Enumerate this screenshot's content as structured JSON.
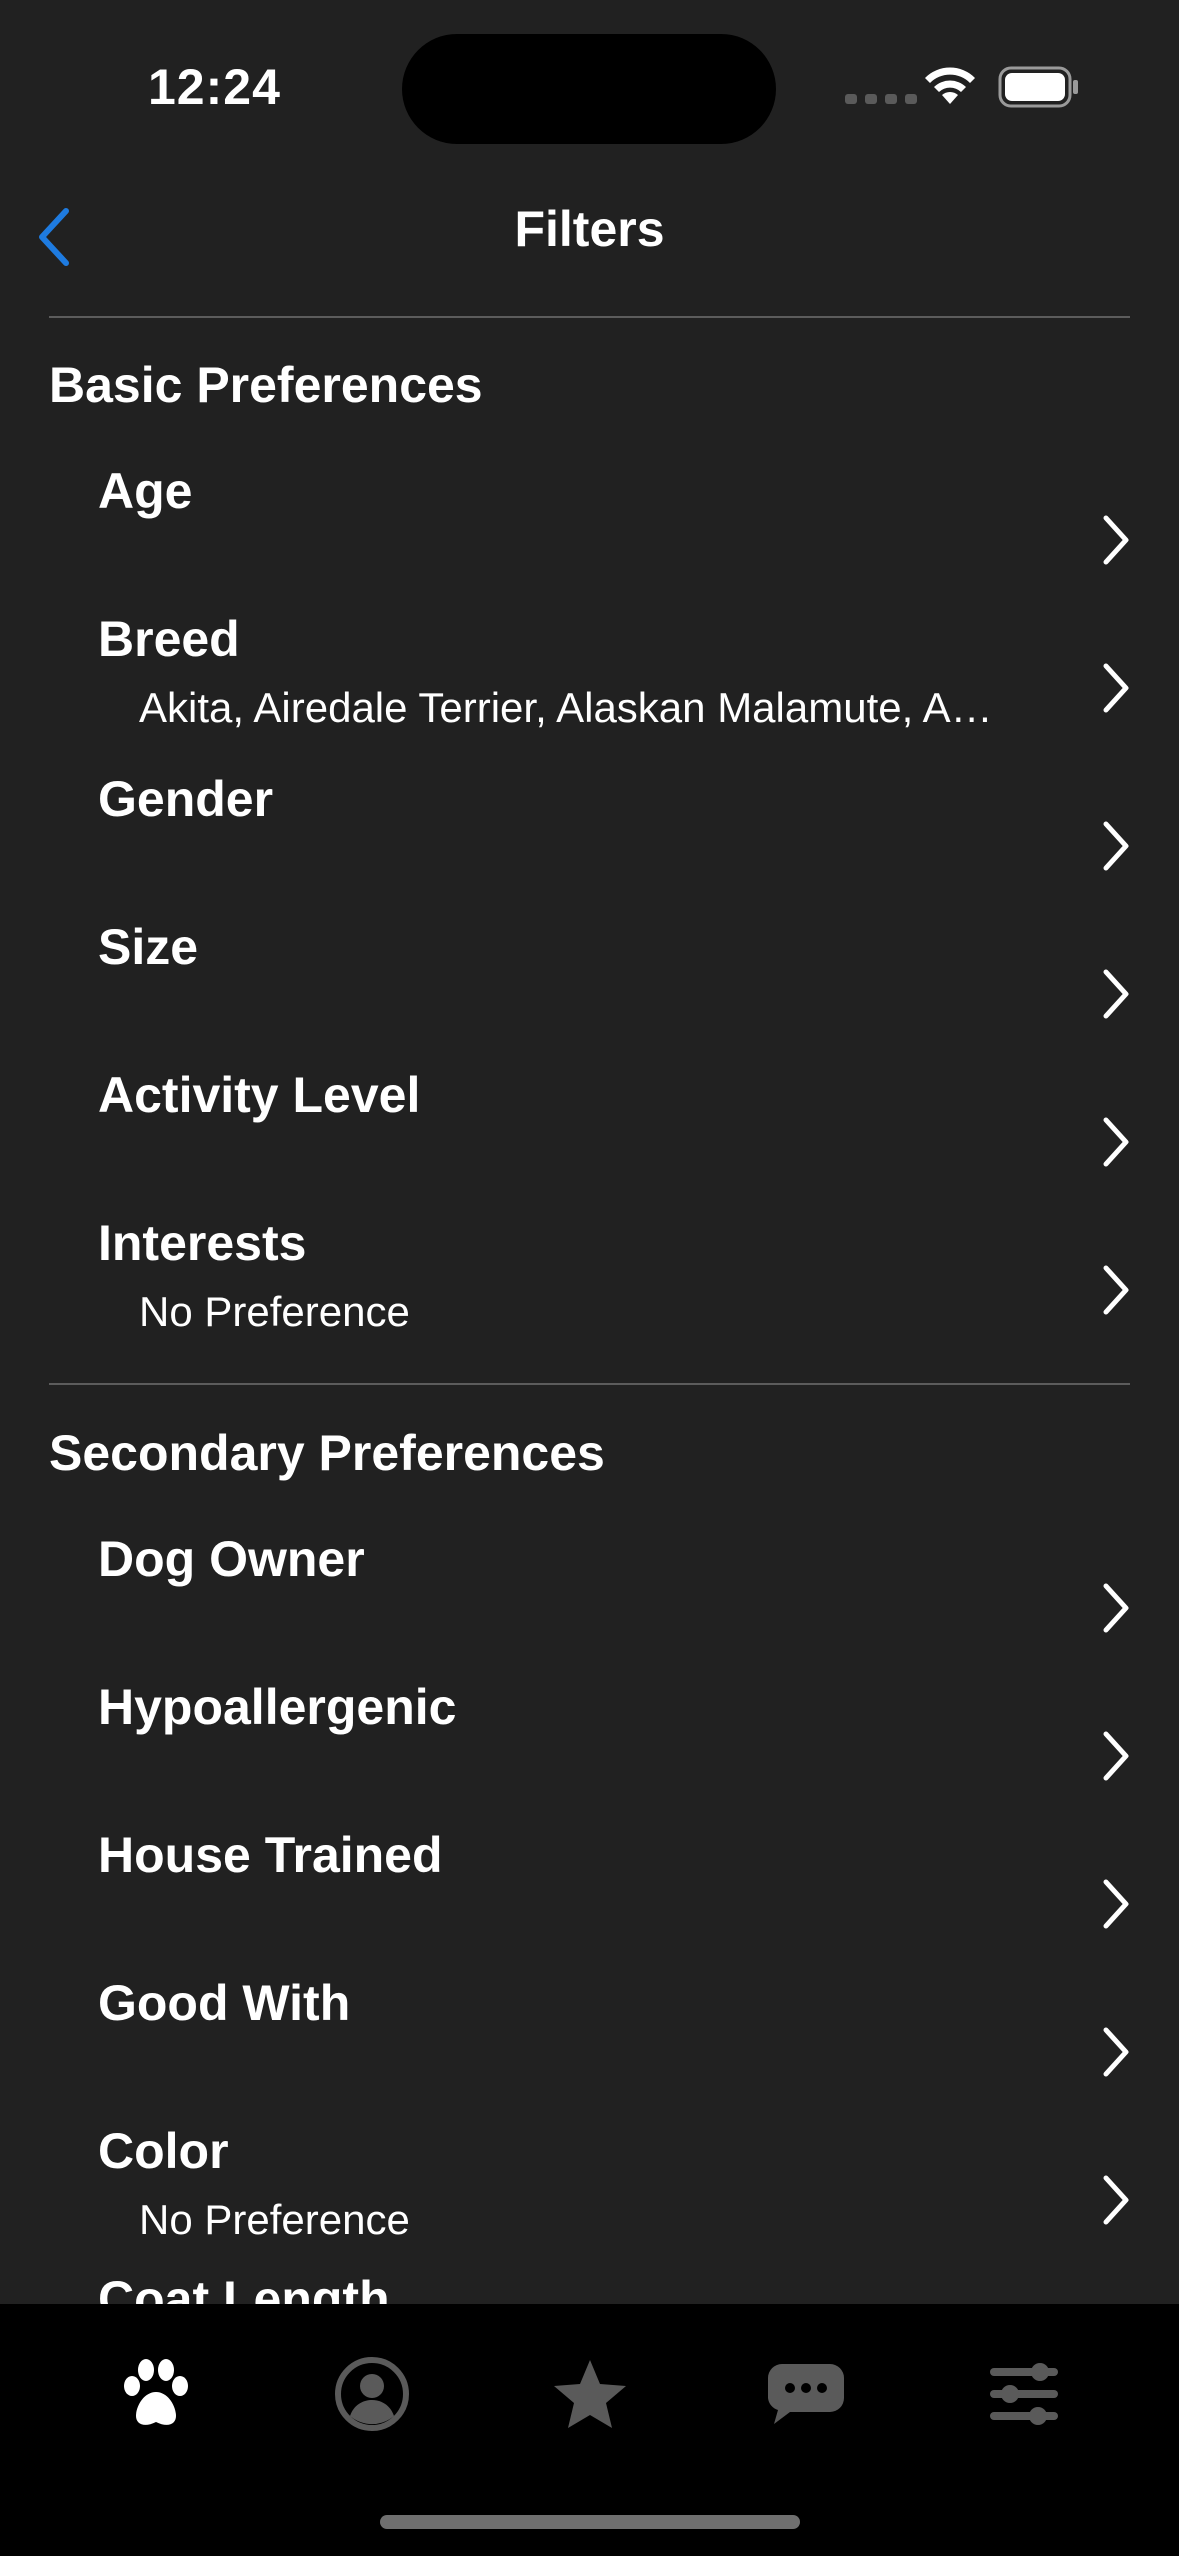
{
  "status_bar": {
    "time": "12:24"
  },
  "nav": {
    "title": "Filters",
    "back_icon": "chevron-left-icon"
  },
  "colors": {
    "background": "#212121",
    "accent": "#1E7BE0",
    "tab_active": "#FFFFFF",
    "tab_inactive": "#5A5A5A",
    "tab_bar": "#000000"
  },
  "basic": {
    "title": "Basic Preferences",
    "items": [
      {
        "label": "Age",
        "value": ""
      },
      {
        "label": "Breed",
        "value": "Akita, Airedale Terrier, Alaskan Malamute, American Bulldog, American Eskimo Dog"
      },
      {
        "label": "Gender",
        "value": ""
      },
      {
        "label": "Size",
        "value": ""
      },
      {
        "label": "Activity Level",
        "value": ""
      },
      {
        "label": "Interests",
        "value": "No Preference"
      }
    ]
  },
  "secondary": {
    "title": "Secondary Preferences",
    "items": [
      {
        "label": "Dog Owner",
        "value": ""
      },
      {
        "label": "Hypoallergenic",
        "value": ""
      },
      {
        "label": "House Trained",
        "value": ""
      },
      {
        "label": "Good With",
        "value": ""
      },
      {
        "label": "Color",
        "value": "No Preference"
      },
      {
        "label": "Coat Length",
        "value": ""
      }
    ]
  },
  "tabs": [
    {
      "icon": "paw-icon",
      "active": true
    },
    {
      "icon": "profile-icon",
      "active": false
    },
    {
      "icon": "star-icon",
      "active": false
    },
    {
      "icon": "chat-icon",
      "active": false
    },
    {
      "icon": "sliders-icon",
      "active": false
    }
  ]
}
